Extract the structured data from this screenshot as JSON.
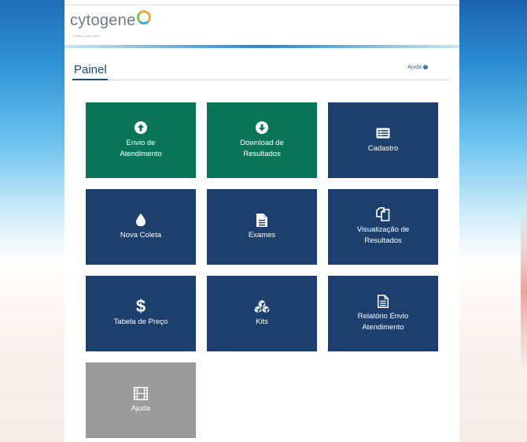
{
  "brand": {
    "name": "cytogene",
    "tagline": "Cuidar é viver bem"
  },
  "page": {
    "title": "Painel",
    "help_label": "Ajuda"
  },
  "tiles": [
    {
      "label": "Envio de\nAtendimento",
      "icon": "arrow-up-circle-icon",
      "color": "#0b7558"
    },
    {
      "label": "Download de\nResultados",
      "icon": "arrow-down-circle-icon",
      "color": "#0b7558"
    },
    {
      "label": "Cadastro",
      "icon": "list-card-icon",
      "color": "#1c3f6e"
    },
    {
      "label": "Nova Coleta",
      "icon": "drop-icon",
      "color": "#1c3f6e"
    },
    {
      "label": "Exames",
      "icon": "document-icon",
      "color": "#1c3f6e"
    },
    {
      "label": "Visualização de\nResultados",
      "icon": "copy-files-icon",
      "color": "#1c3f6e"
    },
    {
      "label": "Tabela de Preço",
      "icon": "dollar-icon",
      "color": "#1c3f6e"
    },
    {
      "label": "Kits",
      "icon": "cubes-icon",
      "color": "#1c3f6e"
    },
    {
      "label": "Relatório Envio\nAtendimento",
      "icon": "report-icon",
      "color": "#1c3f6e"
    },
    {
      "label": "Ajuda",
      "icon": "film-icon",
      "color": "#9b9b9b"
    }
  ]
}
